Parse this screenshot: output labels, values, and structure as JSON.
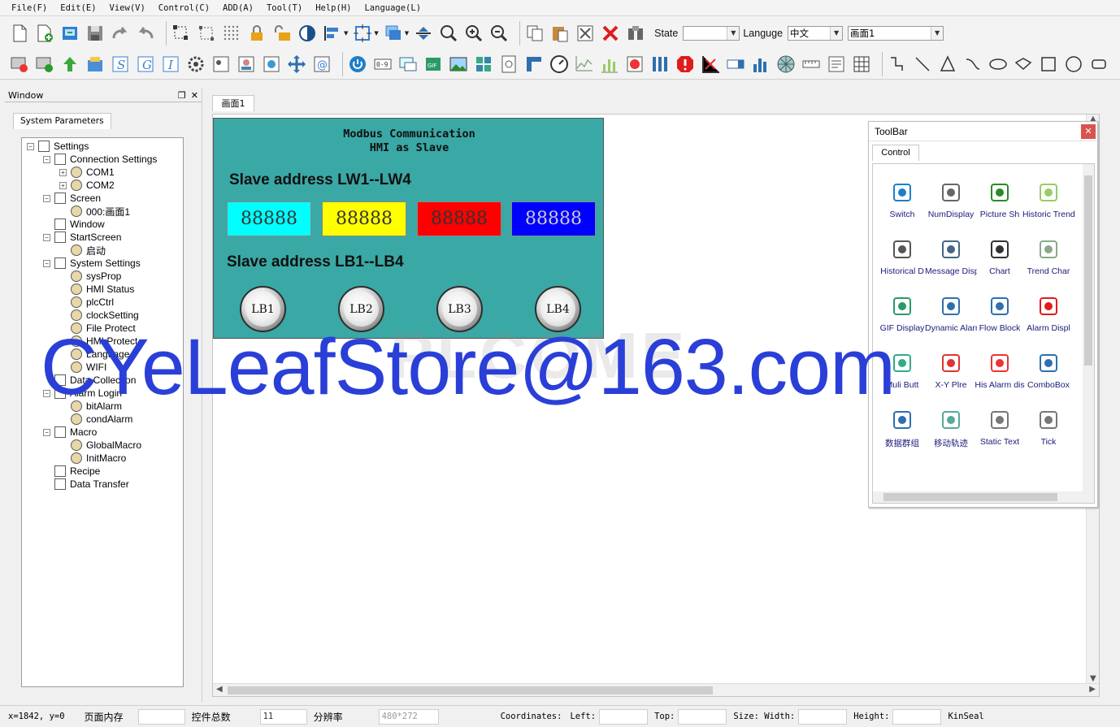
{
  "menu": [
    "File(F)",
    "Edit(E)",
    "View(V)",
    "Control(C)",
    "ADD(A)",
    "Tool(T)",
    "Help(H)",
    "Language(L)"
  ],
  "toolbar": {
    "state_label": "State",
    "state_value": "",
    "language_label": "Languge",
    "language_value": "中文",
    "screen_value": "画面1"
  },
  "left_panel": {
    "title": "Window",
    "tab": "System Parameters",
    "tree": [
      {
        "label": "Settings",
        "level": 0,
        "expanded": true
      },
      {
        "label": "Connection Settings",
        "level": 1,
        "expanded": true
      },
      {
        "label": "COM1",
        "level": 2,
        "expanded": false
      },
      {
        "label": "COM2",
        "level": 2,
        "expanded": false
      },
      {
        "label": "Screen",
        "level": 1,
        "expanded": true
      },
      {
        "label": "000:画面1",
        "level": 2
      },
      {
        "label": "Window",
        "level": 1
      },
      {
        "label": "StartScreen",
        "level": 1,
        "expanded": true
      },
      {
        "label": "启动",
        "level": 2
      },
      {
        "label": "System Settings",
        "level": 1,
        "expanded": true
      },
      {
        "label": "sysProp",
        "level": 2
      },
      {
        "label": "HMI Status",
        "level": 2
      },
      {
        "label": "plcCtrl",
        "level": 2
      },
      {
        "label": "clockSetting",
        "level": 2
      },
      {
        "label": "File Protect",
        "level": 2
      },
      {
        "label": "HMI Protect",
        "level": 2
      },
      {
        "label": "Language",
        "level": 2
      },
      {
        "label": "WIFI",
        "level": 2
      },
      {
        "label": "Data Collection",
        "level": 1
      },
      {
        "label": "Alarm Login",
        "level": 1,
        "expanded": true
      },
      {
        "label": "bitAlarm",
        "level": 2
      },
      {
        "label": "condAlarm",
        "level": 2
      },
      {
        "label": "Macro",
        "level": 1,
        "expanded": true
      },
      {
        "label": "GlobalMacro",
        "level": 2
      },
      {
        "label": "InitMacro",
        "level": 2
      },
      {
        "label": "Recipe",
        "level": 1
      },
      {
        "label": "Data Transfer",
        "level": 1
      }
    ]
  },
  "doc_tab": "画面1",
  "hmi": {
    "title_line1": "Modbus Communication",
    "title_line2": "HMI as Slave",
    "lw_heading": "Slave address LW1--LW4",
    "lb_heading": "Slave address LB1--LB4",
    "num_displays": [
      {
        "value": "88888",
        "color": "#00ffff"
      },
      {
        "value": "88888",
        "color": "#ffff00"
      },
      {
        "value": "88888",
        "color": "#ff0000"
      },
      {
        "value": "88888",
        "color": "#0000ff"
      }
    ],
    "buttons": [
      "LB1",
      "LB2",
      "LB3",
      "LB4"
    ]
  },
  "toolbox": {
    "title": "ToolBar",
    "tab": "Control",
    "items": [
      "Switch",
      "NumDisplay",
      "Picture Sh",
      "Historic Trend",
      "Historical D",
      "Message Disp",
      "Chart",
      "Trend Char",
      "GIF Display",
      "Dynamic Alarm",
      "Flow Block",
      "Alarm Displ",
      "Muli Butt",
      "X-Y Plre",
      "His Alarm dis",
      "ComboBox",
      "数据群组",
      "移动轨迹",
      "Static Text",
      "Tick"
    ]
  },
  "watermark": {
    "text": "CYeLeafStore@163.com",
    "back_text": "PLCOME"
  },
  "status": {
    "coords": "x=1842, y=0",
    "page_mem_label": "页面内存",
    "page_mem_value": "",
    "ctrl_total_label": "控件总数",
    "ctrl_total_value": "11",
    "resolution_label": "分辨率",
    "resolution_value": "480*272",
    "coordinates_label": "Coordinates:",
    "left_label": "Left:",
    "left_value": "",
    "top_label": "Top:",
    "top_value": "",
    "size_label": "Size: Width:",
    "width_value": "",
    "height_label": "Height:",
    "height_value": "",
    "brand": "KinSeal"
  },
  "colors": {
    "hmi_bg": "#3aa8a5",
    "watermark": "#2a3fd8"
  }
}
